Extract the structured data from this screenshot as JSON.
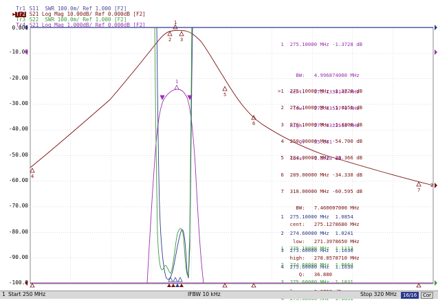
{
  "traces": [
    {
      "id": "Tr1",
      "text": "S11  SWR 100.0m/ Ref 1.000 [F2]",
      "color": "#4b4b9a",
      "active": false
    },
    {
      "id": "Tr2",
      "text": "S21 Log Mag 10.00dB/ Ref 0.000dB [F2]",
      "color": "#7a1010",
      "active": true
    },
    {
      "id": "Tr3",
      "text": "S22  SWR 100.0m/ Ref 1.000 [F2]",
      "color": "#3a9a3a",
      "active": false
    },
    {
      "id": "Tr4",
      "text": "S21 Log Mag 1.000dB/ Ref 0.000dB [F2]",
      "color": "#9a2fb0",
      "active": false
    }
  ],
  "y_axis": [
    "0.000",
    "-10.00",
    "-20.00",
    "-30.00",
    "-40.00",
    "-50.00",
    "-60.00",
    "-70.00",
    "-80.00",
    "-90.00",
    "-100.0"
  ],
  "tr4_markers": {
    "color": "#9a2fb0",
    "lines": [
      " 1  275.10000 MHz -1.3728 dB",
      "",
      "      BW:   4.996874000 MHz",
      "    cent:   275.1338140 MHz",
      "     low:   272.6353770 MHz",
      "    high:   277.6322510 MHz",
      "       Q:   55.061",
      "    loss:  -1.3728 dB"
    ]
  },
  "tr2_markers": {
    "color": "#7a1010",
    "lines": [
      ">1  275.10000 MHz -1.3728 dB",
      " 2  274.10000 MHz -1.4151 dB",
      " 3  276.10000 MHz -1.4306 dB",
      " 4  250.00000 MHz -54.700 dB",
      " 5  284.00000 MHz -23.366 dB",
      " 6  289.00000 MHz -34.330 dB",
      " 7  318.00000 MHz -60.595 dB",
      "      BW:   7.460007000 MHz",
      "    cent:   275.1278680 MHz",
      "     low:   271.3978650 MHz",
      "    high:   278.8578710 MHz",
      "       Q:   36.880",
      "    loss:  -1.3728 dB"
    ]
  },
  "tr1_markers": {
    "color": "#2b3a8c",
    "lines": [
      " 1  275.10000 MHz  1.0854",
      " 2  274.60000 MHz  1.0241",
      " 3  275.60000 MHz  1.1630",
      " 4  275.60000 MHz  1.1630"
    ]
  },
  "tr3_markers": {
    "color": "#3a9a3a",
    "lines": [
      " 1  275.10000 MHz  1.1113",
      " 2  274.60000 MHz  1.0664",
      " 3  275.60000 MHz  1.1831",
      " 4  275.60000 MHz  1.1831"
    ]
  },
  "marker_tags": [
    "1",
    "2",
    "3",
    "4",
    "5",
    "6",
    "7"
  ],
  "status": {
    "channel": "1",
    "start": "Start 250 MHz",
    "ifbw": "IFBW 10 kHz",
    "stop": "Stop 320 MHz",
    "sweep": "16/16",
    "cor": "Cor"
  }
}
